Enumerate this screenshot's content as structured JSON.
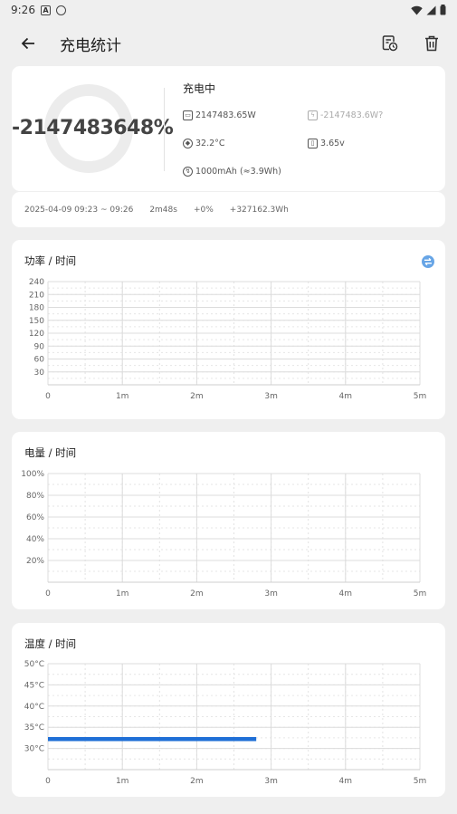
{
  "status_bar": {
    "time": "9:26"
  },
  "app_bar": {
    "title": "充电统计"
  },
  "summary": {
    "percent": "-2147483648%",
    "state": "充电中",
    "power": "2147483.65W",
    "power_alt": "-2147483.6W?",
    "temperature": "32.2°C",
    "voltage": "3.65v",
    "capacity": "1000mAh (≈3.9Wh)"
  },
  "session": {
    "time_range": "2025-04-09  09:23 ~ 09:26",
    "duration": "2m48s",
    "percent_change": "+0%",
    "energy": "+327162.3Wh"
  },
  "charts": [
    {
      "title": "功率 / 时间",
      "y_ticks": [
        "240",
        "210",
        "180",
        "150",
        "120",
        "90",
        "60",
        "30"
      ],
      "x_ticks": [
        "0",
        "1m",
        "2m",
        "3m",
        "4m",
        "5m"
      ],
      "has_swap_button": true
    },
    {
      "title": "电量 / 时间",
      "y_ticks": [
        "100%",
        "80%",
        "60%",
        "40%",
        "20%"
      ],
      "x_ticks": [
        "0",
        "1m",
        "2m",
        "3m",
        "4m",
        "5m"
      ],
      "has_swap_button": false
    },
    {
      "title": "温度 / 时间",
      "y_ticks": [
        "50°C",
        "45°C",
        "40°C",
        "35°C",
        "30°C"
      ],
      "x_ticks": [
        "0",
        "1m",
        "2m",
        "3m",
        "4m",
        "5m"
      ],
      "has_swap_button": false
    }
  ],
  "temperature_series": {
    "color": "#1f6fd6",
    "x_start_min": 0,
    "x_end_min": 2.8,
    "value_c": 32.2
  },
  "colors": {
    "accent": "#1f6fd6",
    "swap_button": "#67a5e6"
  }
}
